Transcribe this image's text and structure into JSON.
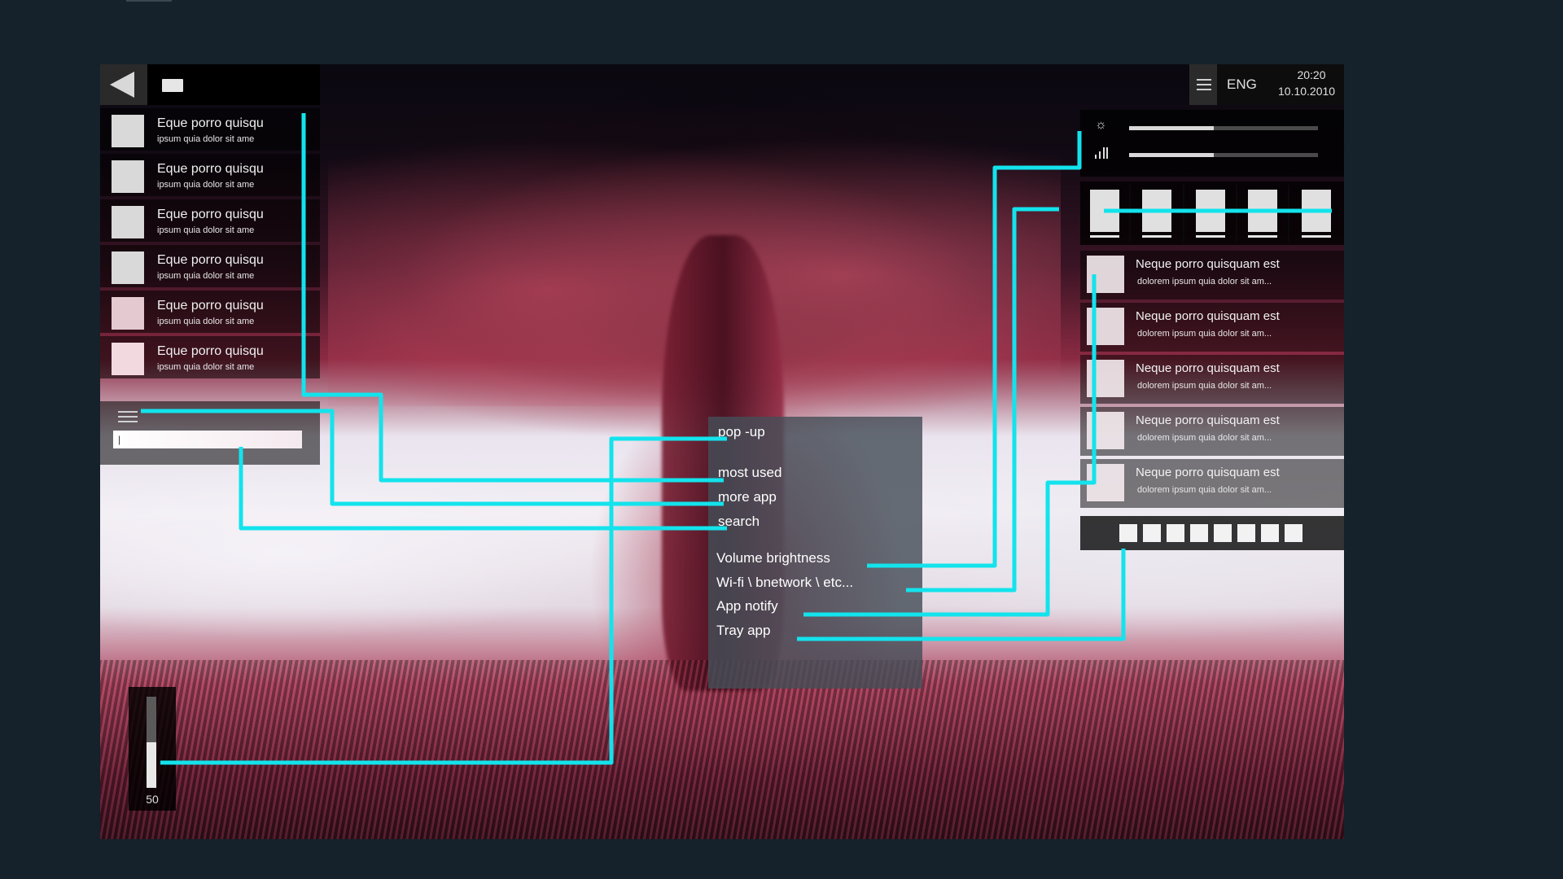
{
  "left_panel": {
    "apps": [
      {
        "title": "Eque porro quisqu",
        "subtitle": "ipsum quia dolor sit ame"
      },
      {
        "title": "Eque porro quisqu",
        "subtitle": "ipsum quia dolor sit ame"
      },
      {
        "title": "Eque porro quisqu",
        "subtitle": "ipsum quia dolor sit ame"
      },
      {
        "title": "Eque porro quisqu",
        "subtitle": "ipsum quia dolor sit ame"
      },
      {
        "title": "Eque porro quisqu",
        "subtitle": "ipsum quia dolor sit ame"
      },
      {
        "title": "Eque porro quisqu",
        "subtitle": "ipsum quia dolor sit ame"
      }
    ],
    "search_value": "|"
  },
  "status": {
    "language": "ENG",
    "time": "20:20",
    "date": "10.10.2010"
  },
  "controls": {
    "brightness_level": 0.45,
    "volume_level": 0.45
  },
  "notifications": [
    {
      "title": "Neque porro quisquam est",
      "subtitle": "dolorem ipsum quia dolor sit am..."
    },
    {
      "title": "Neque porro quisquam est",
      "subtitle": "dolorem ipsum quia dolor sit am..."
    },
    {
      "title": "Neque porro quisquam est",
      "subtitle": "dolorem ipsum quia dolor sit am..."
    },
    {
      "title": "Neque porro quisquam est",
      "subtitle": "dolorem ipsum quia dolor sit am..."
    },
    {
      "title": "Neque porro quisquam est",
      "subtitle": "dolorem ipsum quia dolor sit am..."
    }
  ],
  "tray_count": 8,
  "volume_widget": {
    "value": "50",
    "level": 0.5
  },
  "legend": {
    "popup": "pop -up",
    "most_used": "most used",
    "more_app": "more app",
    "search": "search",
    "volume_brightness": "Volume brightness",
    "wifi": "Wi-fi \\ bnetwork \\ etc...",
    "app_notify": "App notify",
    "tray_app": "Tray app"
  },
  "colors": {
    "annotation": "#13e3ec",
    "background": "#15212b"
  },
  "icons": [
    "back-triangle-icon",
    "window-icon",
    "menu-icon",
    "sun-icon",
    "volume-icon"
  ]
}
